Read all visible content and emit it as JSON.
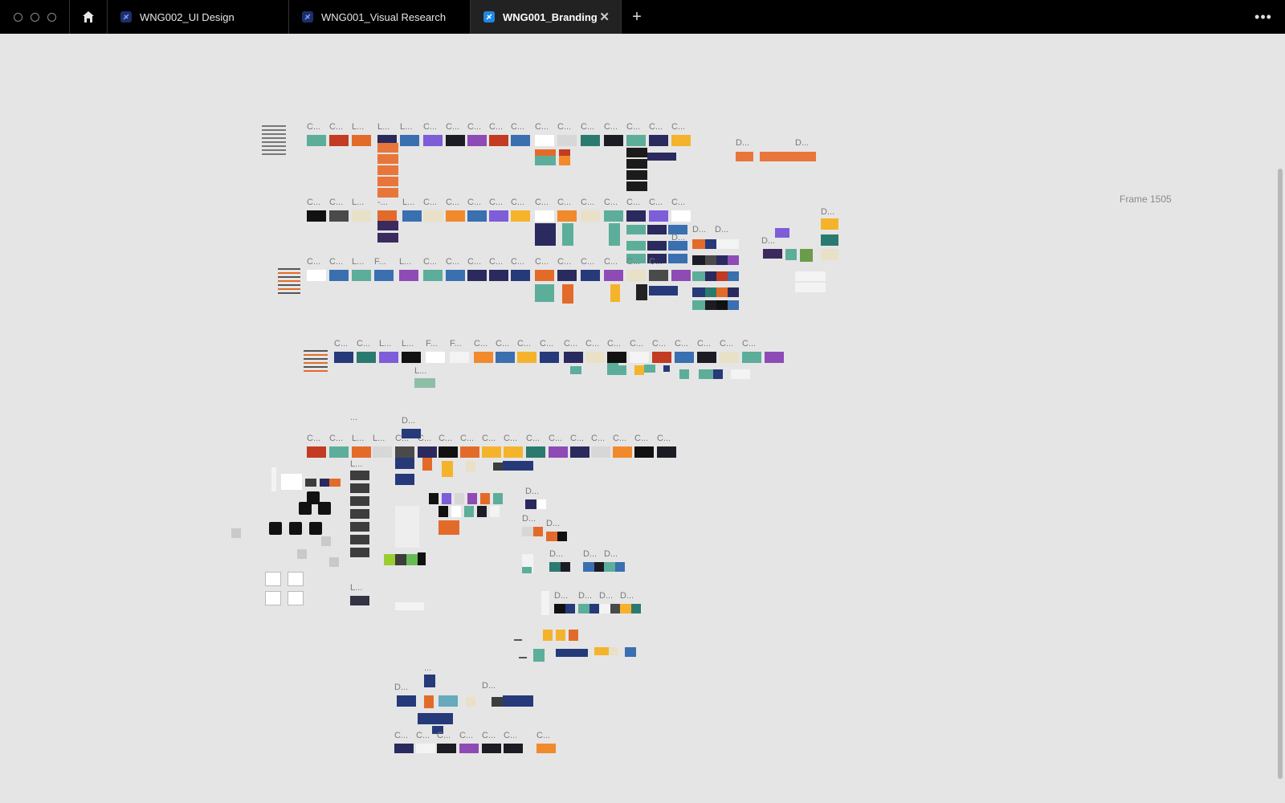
{
  "tabs": [
    {
      "label": "WNG002_UI Design",
      "icon": "app-file-icon"
    },
    {
      "label": "WNG001_Visual Research",
      "icon": "app-file-icon"
    },
    {
      "label": "WNG001_Branding",
      "icon": "app-file-icon",
      "active": true
    }
  ],
  "frame_label": "Frame 1505",
  "row_labels": {
    "row1": [
      "C...",
      "C...",
      "L...",
      "L...",
      "L...",
      "C...",
      "C...",
      "C...",
      "C...",
      "C...",
      "C...",
      "C...",
      "C...",
      "C...",
      "C...",
      "C...",
      "C..."
    ],
    "row1_right": [
      "D...",
      "D..."
    ],
    "row2": [
      "C...",
      "C...",
      "L...",
      "-...",
      "L...",
      "C...",
      "C...",
      "C...",
      "C...",
      "C...",
      "C...",
      "C...",
      "C...",
      "C...",
      "C...",
      "C...",
      "C..."
    ],
    "row2_right": [
      "D...",
      "D...",
      "D...",
      "D...",
      "D..."
    ],
    "row3": [
      "C...",
      "C...",
      "L...",
      "F...",
      "L...",
      "C...",
      "C...",
      "C...",
      "C...",
      "C...",
      "C...",
      "C...",
      "C...",
      "C...",
      "C...",
      "C..."
    ],
    "row4": [
      "C...",
      "C...",
      "L...",
      "L...",
      "F...",
      "F...",
      "C...",
      "C...",
      "C...",
      "C...",
      "C...",
      "C...",
      "C...",
      "C...",
      "C...",
      "C...",
      "C...",
      "C...",
      "C..."
    ],
    "row4_extra": [
      "L..."
    ],
    "row5": [
      "C...",
      "C...",
      "L...",
      "L...",
      "C...",
      "C...",
      "C...",
      "C...",
      "C...",
      "C...",
      "C...",
      "C...",
      "C...",
      "C...",
      "C...",
      "C...",
      "C..."
    ],
    "row5_extra": [
      "D...",
      "...",
      "L...",
      "L..."
    ],
    "lower": [
      "D...",
      "D...",
      "D...",
      "D...",
      "D...",
      "D...",
      "D...",
      "D...",
      "D...",
      "D..."
    ],
    "bottom": [
      "D...",
      "D...",
      "...",
      "C...",
      "C...",
      "C...",
      "C...",
      "C...",
      "C...",
      "C..."
    ]
  },
  "colors": {
    "titlebar": "#000000",
    "canvas": "#e5e5e5",
    "active_tab_icon": "#1e88e5",
    "tab_icon": "#1d2f6a"
  }
}
